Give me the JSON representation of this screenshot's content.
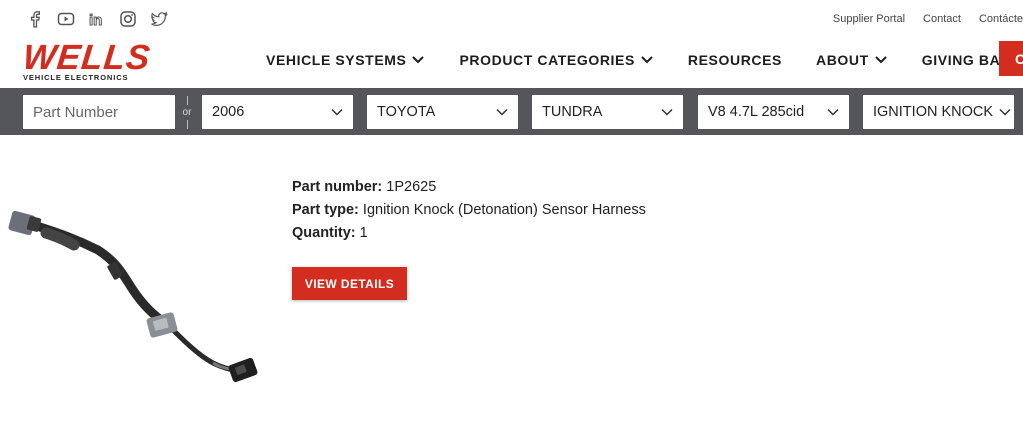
{
  "social": {
    "icons": [
      "facebook-icon",
      "youtube-icon",
      "linkedin-icon",
      "instagram-icon",
      "twitter-icon"
    ]
  },
  "toplinks": {
    "supplier_portal": "Supplier Portal",
    "contact": "Contact",
    "contacte": "Contácte"
  },
  "logo": {
    "name": "WELLS",
    "tagline": "VEHICLE ELECTRONICS"
  },
  "nav": {
    "vehicle_systems": "VEHICLE SYSTEMS",
    "product_categories": "PRODUCT CATEGORIES",
    "resources": "RESOURCES",
    "about": "ABOUT",
    "giving_back": "GIVING BACK",
    "cta": "C"
  },
  "search": {
    "part_number_placeholder": "Part Number",
    "or": "or",
    "year": "2006",
    "make": "TOYOTA",
    "model": "TUNDRA",
    "engine": "V8 4.7L 285cid",
    "category": "IGNITION KNOCK"
  },
  "product": {
    "part_number_label": "Part number:",
    "part_number": "1P2625",
    "part_type_label": "Part type:",
    "part_type": "Ignition Knock (Detonation) Sensor Harness",
    "quantity_label": "Quantity:",
    "quantity": "1",
    "view_details": "VIEW DETAILS"
  },
  "colors": {
    "brand_red": "#d32d1f",
    "search_bar": "#555659"
  }
}
